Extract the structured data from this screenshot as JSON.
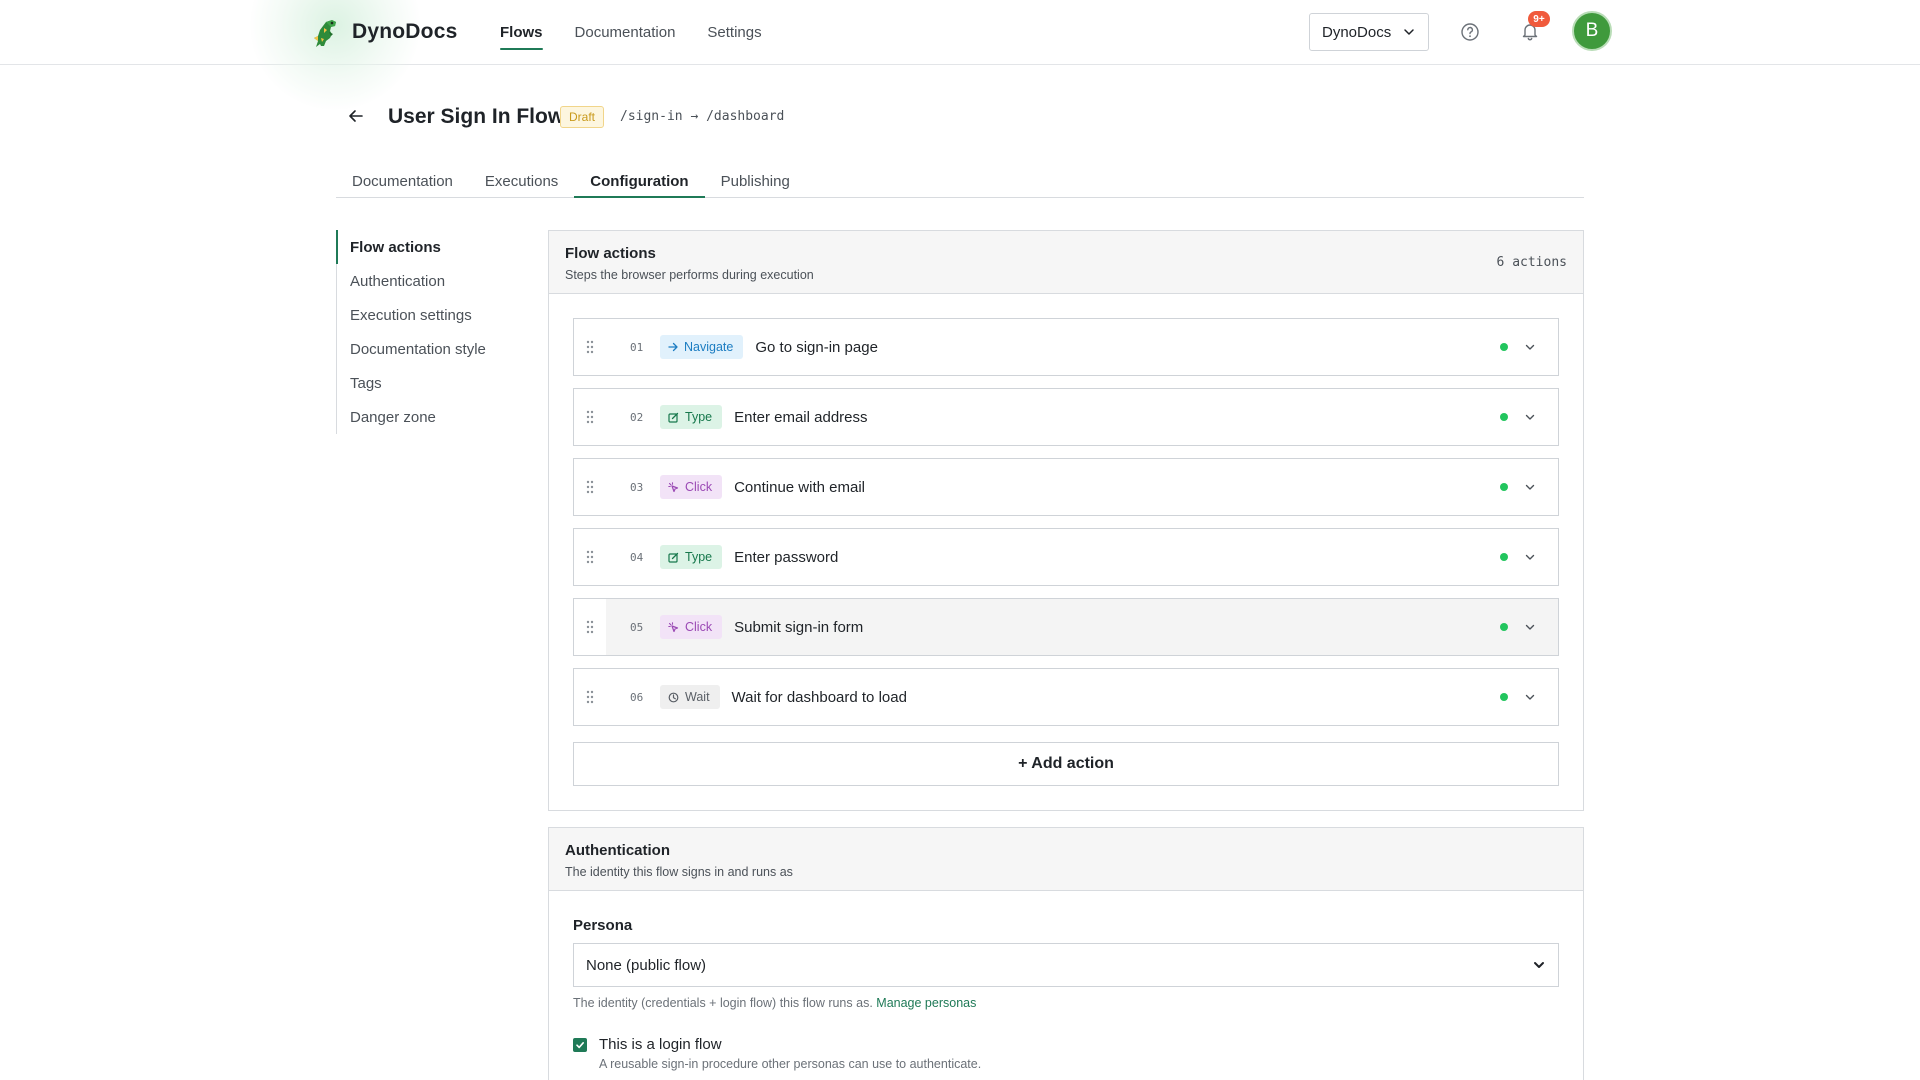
{
  "app": {
    "name": "DynoDocs"
  },
  "nav": [
    {
      "label": "Flows",
      "active": true
    },
    {
      "label": "Documentation",
      "active": false
    },
    {
      "label": "Settings",
      "active": false
    }
  ],
  "header": {
    "workspace": "DynoDocs",
    "notifications_count": "9+",
    "avatar_initial": "B"
  },
  "page": {
    "title": "User Sign In Flow",
    "status": "Draft",
    "route": "/sign-in → /dashboard"
  },
  "tabs": [
    {
      "label": "Documentation",
      "active": false
    },
    {
      "label": "Executions",
      "active": false
    },
    {
      "label": "Configuration",
      "active": true
    },
    {
      "label": "Publishing",
      "active": false
    }
  ],
  "sidenav": [
    {
      "label": "Flow actions",
      "active": true
    },
    {
      "label": "Authentication",
      "active": false
    },
    {
      "label": "Execution settings",
      "active": false
    },
    {
      "label": "Documentation style",
      "active": false
    },
    {
      "label": "Tags",
      "active": false
    },
    {
      "label": "Danger zone",
      "active": false
    }
  ],
  "flow_actions": {
    "title": "Flow actions",
    "subtitle": "Steps the browser performs during execution",
    "count": "6 actions",
    "items": [
      {
        "num": "01",
        "type": "Navigate",
        "icon": "arrow-right-icon",
        "label": "Go to sign-in page"
      },
      {
        "num": "02",
        "type": "Type",
        "icon": "edit-icon",
        "label": "Enter email address"
      },
      {
        "num": "03",
        "type": "Click",
        "icon": "pointer-icon",
        "label": "Continue with email"
      },
      {
        "num": "04",
        "type": "Type",
        "icon": "edit-icon",
        "label": "Enter password"
      },
      {
        "num": "05",
        "type": "Click",
        "icon": "pointer-icon",
        "label": "Submit sign-in form"
      },
      {
        "num": "06",
        "type": "Wait",
        "icon": "clock-icon",
        "label": "Wait for dashboard to load"
      }
    ],
    "add_label": "+ Add action"
  },
  "authentication": {
    "title": "Authentication",
    "subtitle": "The identity this flow signs in and runs as",
    "persona_label": "Persona",
    "persona_value": "None (public flow)",
    "help_text": "The identity (credentials + login flow) this flow runs as.",
    "help_link": "Manage personas",
    "login_flow_label": "This is a login flow",
    "login_flow_help": "A reusable sign-in procedure other personas can use to authenticate.",
    "login_flow_checked": true
  },
  "colors": {
    "accent": "#1f7a57",
    "status_ok": "#22c55e",
    "draft": "#c99a1c",
    "badge": "#f05a3c"
  }
}
